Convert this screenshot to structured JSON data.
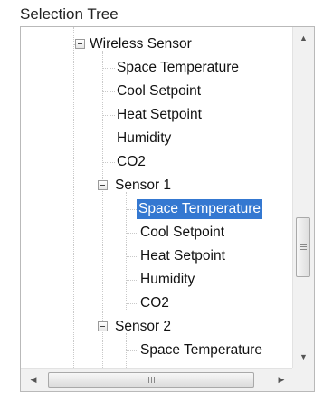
{
  "group_title": "Selection Tree",
  "tree": {
    "wireless_sensor": {
      "label": "Wireless Sensor",
      "children": [
        "Space Temperature",
        "Cool Setpoint",
        "Heat Setpoint",
        "Humidity",
        "CO2"
      ]
    },
    "sensor1": {
      "label": "Sensor 1",
      "children": [
        "Space Temperature",
        "Cool Setpoint",
        "Heat Setpoint",
        "Humidity",
        "CO2"
      ],
      "selected_child": "Space Temperature"
    },
    "sensor2": {
      "label": "Sensor 2",
      "children": [
        "Space Temperature"
      ]
    }
  },
  "colors": {
    "selection_background": "#3478d1",
    "selection_text": "#ffffff"
  },
  "icons": {
    "collapse": "minus-box-icon",
    "scroll_up": "up-arrow-icon",
    "scroll_down": "down-arrow-icon",
    "scroll_left": "left-arrow-icon",
    "scroll_right": "right-arrow-icon"
  }
}
